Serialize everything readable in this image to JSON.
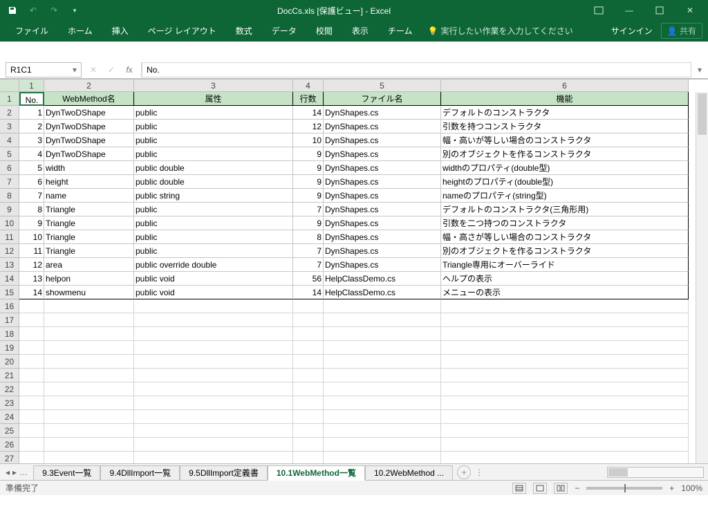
{
  "title": "DocCs.xls [保護ビュー] - Excel",
  "qat": {
    "save": "save",
    "undo": "undo",
    "redo": "redo"
  },
  "winbtns": {
    "ribbonopt": "▢",
    "min": "—",
    "max": "☐",
    "close": "✕"
  },
  "ribbon": [
    "ファイル",
    "ホーム",
    "挿入",
    "ページ レイアウト",
    "数式",
    "データ",
    "校閲",
    "表示",
    "チーム"
  ],
  "tell": "実行したい作業を入力してください",
  "signin": "サインイン",
  "share": "共有",
  "namebox": "R1C1",
  "fx": "No.",
  "colHeaders": [
    "1",
    "2",
    "3",
    "4",
    "5",
    "6"
  ],
  "headers": {
    "c1": "No.",
    "c2": "WebMethod名",
    "c3": "属性",
    "c4": "行数",
    "c5": "ファイル名",
    "c6": "機能"
  },
  "rows": [
    {
      "no": "1",
      "name": "DynTwoDShape",
      "attr": "public",
      "lines": "14",
      "file": "DynShapes.cs",
      "func": "デフォルトのコンストラクタ"
    },
    {
      "no": "2",
      "name": "DynTwoDShape",
      "attr": "public",
      "lines": "12",
      "file": "DynShapes.cs",
      "func": "引数を持つコンストラクタ"
    },
    {
      "no": "3",
      "name": "DynTwoDShape",
      "attr": "public",
      "lines": "10",
      "file": "DynShapes.cs",
      "func": "幅・高いが等しい場合のコンストラクタ"
    },
    {
      "no": "4",
      "name": "DynTwoDShape",
      "attr": "public",
      "lines": "9",
      "file": "DynShapes.cs",
      "func": "別のオブジェクトを作るコンストラクタ"
    },
    {
      "no": "5",
      "name": "width",
      "attr": "public double",
      "lines": "9",
      "file": "DynShapes.cs",
      "func": "widthのプロパティ(double型)"
    },
    {
      "no": "6",
      "name": "height",
      "attr": "public double",
      "lines": "9",
      "file": "DynShapes.cs",
      "func": "heightのプロパティ(double型)"
    },
    {
      "no": "7",
      "name": "name",
      "attr": "public string",
      "lines": "9",
      "file": "DynShapes.cs",
      "func": "nameのプロパティ(string型)"
    },
    {
      "no": "8",
      "name": "Triangle",
      "attr": "public",
      "lines": "7",
      "file": "DynShapes.cs",
      "func": "デフォルトのコンストラクタ(三角形用)"
    },
    {
      "no": "9",
      "name": "Triangle",
      "attr": "public",
      "lines": "9",
      "file": "DynShapes.cs",
      "func": "引数を二つ持つのコンストラクタ"
    },
    {
      "no": "10",
      "name": "Triangle",
      "attr": "public",
      "lines": "8",
      "file": "DynShapes.cs",
      "func": "幅・高さが等しい場合のコンストラクタ"
    },
    {
      "no": "11",
      "name": "Triangle",
      "attr": "public",
      "lines": "7",
      "file": "DynShapes.cs",
      "func": "別のオブジェクトを作るコンストラクタ"
    },
    {
      "no": "12",
      "name": "area",
      "attr": "public override double",
      "lines": "7",
      "file": "DynShapes.cs",
      "func": "Triangle専用にオーバーライド"
    },
    {
      "no": "13",
      "name": "helpon",
      "attr": "public void",
      "lines": "56",
      "file": "HelpClassDemo.cs",
      "func": "ヘルプの表示"
    },
    {
      "no": "14",
      "name": "showmenu",
      "attr": "public void",
      "lines": "14",
      "file": "HelpClassDemo.cs",
      "func": "メニューの表示"
    }
  ],
  "emptyRows": 12,
  "sheetTabs": [
    "9.3Event一覧",
    "9.4DllImport一覧",
    "9.5DllImport定義書",
    "10.1WebMethod一覧",
    "10.2WebMethod ..."
  ],
  "activeTab": 3,
  "status": "準備完了",
  "zoom": "100%"
}
